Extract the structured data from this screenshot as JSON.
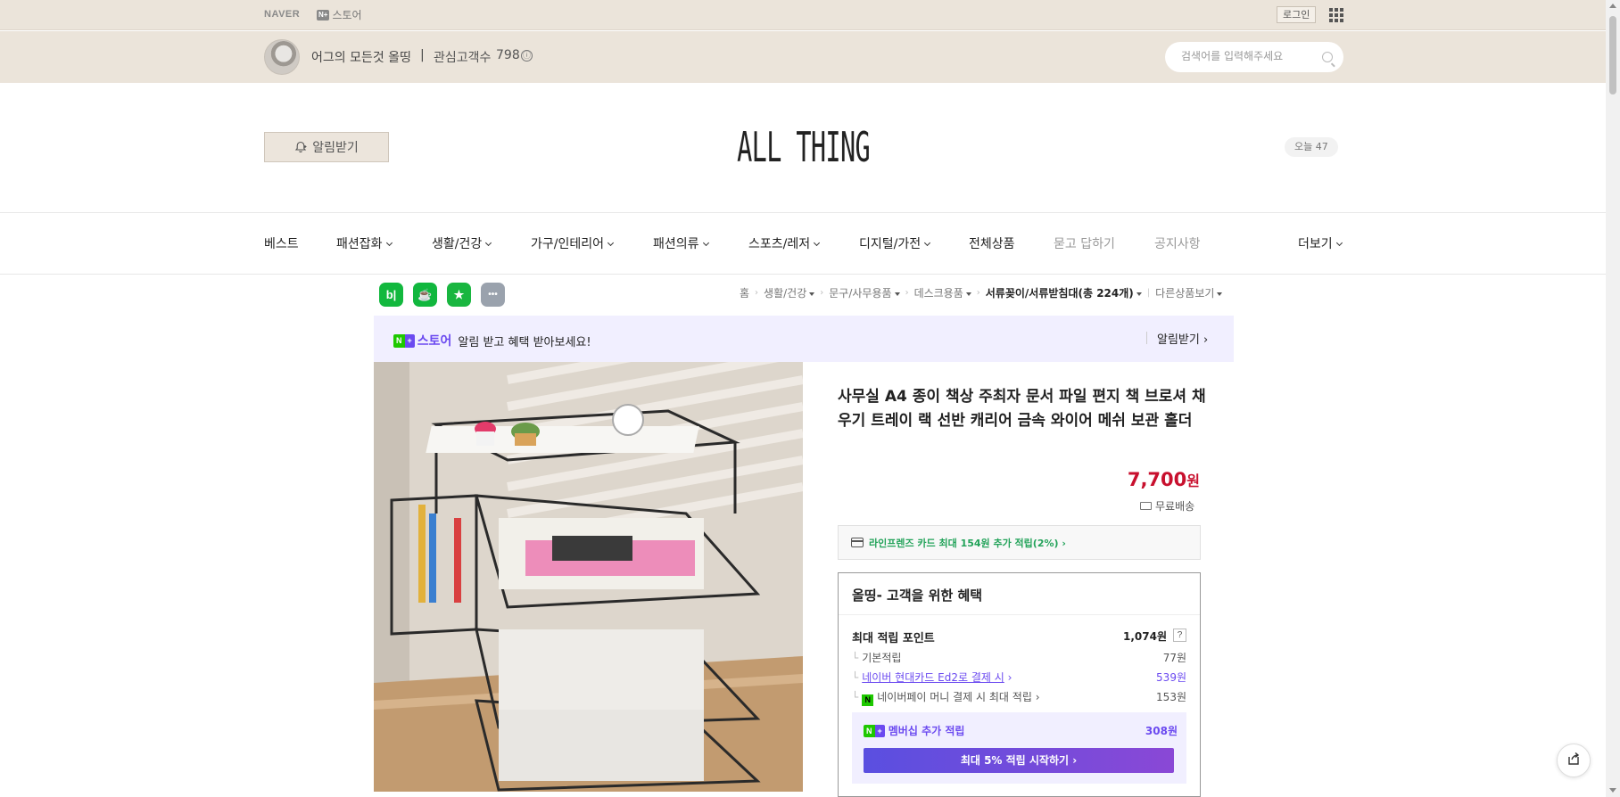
{
  "gnb": {
    "naver_logo": "NAVER",
    "store_badge": "N+",
    "store_label": "스토어",
    "login_label": "로그인",
    "apps_icon": "grid-icon"
  },
  "channel": {
    "name": "어그의 모든것 올띵",
    "separator": "|",
    "fans_label": "관심고객수",
    "fans_count": "798",
    "info_icon": "ⓘ"
  },
  "search": {
    "placeholder": "검색어를 입력해주세요"
  },
  "header": {
    "alarm_label": "알림받기",
    "logo": "ALL THING",
    "today_label": "오늘 47"
  },
  "nav": {
    "items": [
      {
        "label": "베스트",
        "dropdown": false
      },
      {
        "label": "패션잡화",
        "dropdown": true
      },
      {
        "label": "생활/건강",
        "dropdown": true
      },
      {
        "label": "가구/인테리어",
        "dropdown": true
      },
      {
        "label": "패션의류",
        "dropdown": true
      },
      {
        "label": "스포츠/레저",
        "dropdown": true
      },
      {
        "label": "디지털/가전",
        "dropdown": true
      },
      {
        "label": "전체상품",
        "dropdown": false
      },
      {
        "label": "묻고 답하기",
        "dropdown": false
      },
      {
        "label": "공지사항",
        "dropdown": false
      }
    ],
    "more_label": "더보기"
  },
  "share_icons": [
    {
      "name": "band-share-icon",
      "glyph": "b|",
      "color": "#12b83e"
    },
    {
      "name": "cafe-share-icon",
      "glyph": "☕",
      "color": "#11b73e"
    },
    {
      "name": "bookmark-share-icon",
      "glyph": "★",
      "color": "#19b640"
    },
    {
      "name": "more-share-icon",
      "glyph": "•••",
      "color": "#9aa2ad"
    }
  ],
  "breadcrumb": [
    {
      "label": "홈",
      "dropdown": false,
      "strong": false
    },
    {
      "label": "생활/건강",
      "dropdown": true,
      "strong": false
    },
    {
      "label": "문구/사무용품",
      "dropdown": true,
      "strong": false
    },
    {
      "label": "데스크용품",
      "dropdown": true,
      "strong": false
    },
    {
      "label": "서류꽂이/서류받침대(총 224개)",
      "dropdown": true,
      "strong": true
    }
  ],
  "breadcrumb_other": "다른상품보기",
  "banner": {
    "badge_n": "N",
    "badge_plus": "+",
    "store_word": "스토어",
    "message": "알림 받고 혜택 받아보세요!",
    "alarm_label": "알림받기 ›"
  },
  "product": {
    "title": "사무실 A4 종이 책상 주최자 문서 파일 편지 책 브로셔 채우기 트레이 랙 선반 캐리어 금속 와이어 메쉬 보관 홀더",
    "price_number": "7,700",
    "price_unit": "원",
    "shipping": "무료배송",
    "card_offer": "라인프렌즈 카드 최대 154원 추가 적립(2%) ›"
  },
  "benefit": {
    "heading": "올띵- 고객을 위한 혜택",
    "max_points_label": "최대 적립 포인트",
    "max_points_value": "1,074원",
    "help_icon": "?",
    "rows": [
      {
        "label": "기본적립",
        "value": "77원",
        "type": "plain"
      },
      {
        "label": "네이버 현대카드 Ed2로 결제 시",
        "value": "539원",
        "type": "link"
      },
      {
        "label": "네이버페이 머니 결제 시 최대 적립",
        "value": "153원",
        "type": "npay"
      }
    ],
    "member_label": "멤버십 추가 적립",
    "member_value": "308원",
    "member_cta": "최대 5% 적립 시작하기 ›"
  },
  "colors": {
    "topbar_bg": "#ebe4da",
    "price_red": "#c8102e",
    "naver_green": "#1ec800",
    "plus_purple": "#6b4af0"
  }
}
